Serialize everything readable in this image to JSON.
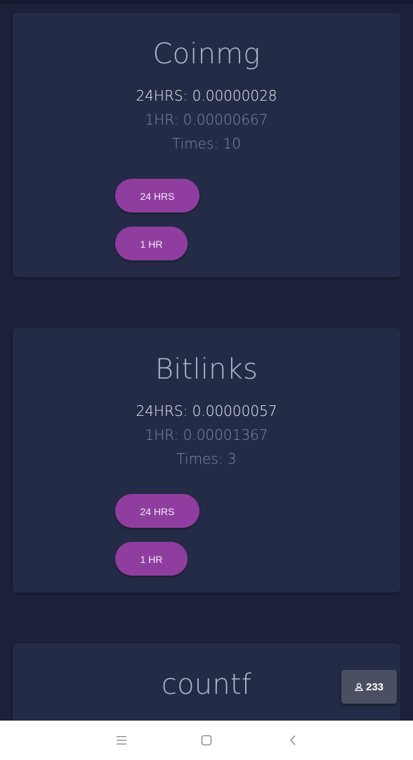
{
  "cards": [
    {
      "name": "Coinmg",
      "stat_24": "24HRS: 0.00000028",
      "stat_1": "1HR: 0.00000667",
      "times": "Times: 10",
      "btn_24": "24 HRS",
      "btn_1": "1 HR"
    },
    {
      "name": "Bitlinks",
      "stat_24": "24HRS: 0.00000057",
      "stat_1": "1HR: 0.00001367",
      "times": "Times: 3",
      "btn_24": "24 HRS",
      "btn_1": "1 HR"
    },
    {
      "name": "countf"
    }
  ],
  "badge": {
    "icon": "user-icon",
    "count": "233"
  },
  "navbar": {
    "icons": [
      "menu-icon",
      "home-square-icon",
      "back-chevron-icon"
    ]
  },
  "colors": {
    "background": "#1c2038",
    "card": "#242b46",
    "accent": "#8f3ea0",
    "title": "#b3b7cd",
    "muted": "#868ba4"
  }
}
